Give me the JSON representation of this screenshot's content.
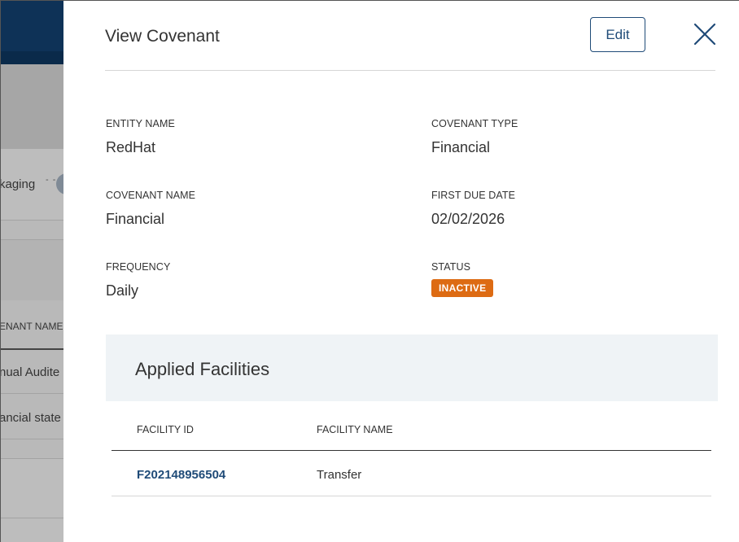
{
  "background": {
    "tab_label": "kaging",
    "column_header": "ENANT NAME",
    "rows": [
      "nual Audite",
      "ancial state"
    ]
  },
  "modal": {
    "title": "View Covenant",
    "edit_label": "Edit",
    "fields": {
      "entity_name": {
        "label": "ENTITY NAME",
        "value": "RedHat"
      },
      "covenant_type": {
        "label": "COVENANT TYPE",
        "value": "Financial"
      },
      "covenant_name": {
        "label": "COVENANT NAME",
        "value": "Financial"
      },
      "first_due_date": {
        "label": "FIRST DUE DATE",
        "value": "02/02/2026"
      },
      "frequency": {
        "label": "FREQUENCY",
        "value": "Daily"
      },
      "status": {
        "label": "STATUS",
        "value": "INACTIVE",
        "color": "#dd6b13"
      }
    },
    "applied_facilities": {
      "title": "Applied Facilities",
      "columns": [
        "FACILITY ID",
        "FACILITY NAME"
      ],
      "rows": [
        {
          "facility_id": "F202148956504",
          "facility_name": "Transfer"
        }
      ]
    }
  },
  "colors": {
    "accent": "#1f4b78",
    "header_bg": "#0e3257",
    "panel_bg": "#eff3f6"
  },
  "icons": {
    "close": "close-icon"
  }
}
